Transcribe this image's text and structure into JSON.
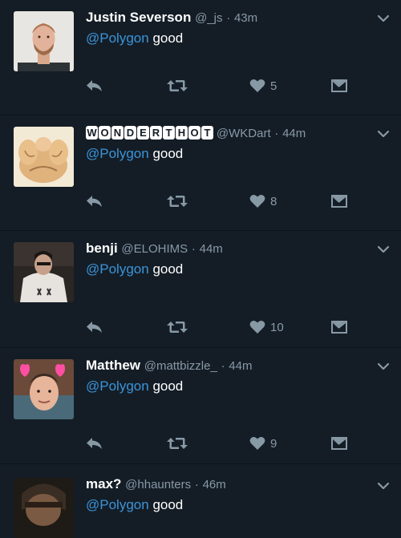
{
  "tweets": [
    {
      "name": "Justin Severson",
      "handle": "@_js",
      "separator": "·",
      "time": "43m",
      "mention": "@Polygon",
      "text": "good",
      "likes": "5",
      "avatar": "man-with-beard-avatar"
    },
    {
      "name": "WONDERTHOT",
      "handle": "@WKDart",
      "separator": "·",
      "time": "44m",
      "mention": "@Polygon",
      "text": "good",
      "likes": "8",
      "avatar": "cartoon-muscle-avatar"
    },
    {
      "name": "benji",
      "handle": "@ELOHIMS",
      "separator": "·",
      "time": "44m",
      "mention": "@Polygon",
      "text": "good",
      "likes": "10",
      "avatar": "person-in-hoodie-avatar"
    },
    {
      "name": "Matthew",
      "handle": "@mattbizzle_",
      "separator": "·",
      "time": "44m",
      "mention": "@Polygon",
      "text": "good",
      "likes": "9",
      "avatar": "face-filter-avatar"
    },
    {
      "name": "max?",
      "handle": "@hhaunters",
      "separator": "·",
      "time": "46m",
      "mention": "@Polygon",
      "text": "good",
      "likes": "",
      "avatar": "dark-face-avatar"
    }
  ],
  "icons": {
    "reply": "reply-icon",
    "retweet": "retweet-icon",
    "like": "heart-icon",
    "dm": "direct-message-icon",
    "more": "chevron-down-icon"
  },
  "colors": {
    "background": "#141d26",
    "mention": "#3b94d9",
    "muted": "#8899a6",
    "icon": "#8899a6"
  }
}
